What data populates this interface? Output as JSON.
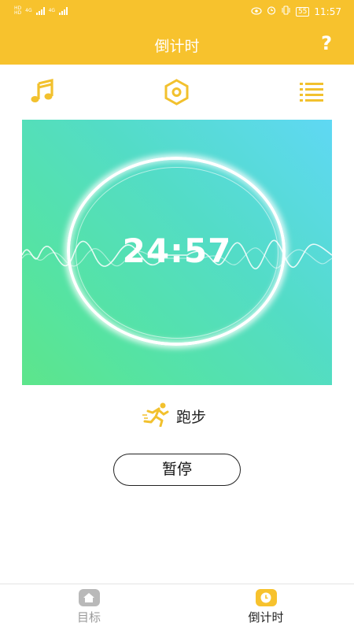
{
  "status_bar": {
    "network_left": [
      "4G",
      "4G"
    ],
    "time": "11:57",
    "battery": "55"
  },
  "header": {
    "title": "倒计时",
    "help_label": "?"
  },
  "toolbar": {
    "music_icon": "music-note-icon",
    "settings_icon": "hexagon-settings-icon",
    "list_icon": "list-icon"
  },
  "timer": {
    "value": "24:57"
  },
  "activity": {
    "icon": "running-person-icon",
    "label": "跑步"
  },
  "pause_button": {
    "label": "暂停"
  },
  "bottom_nav": {
    "items": [
      {
        "label": "目标",
        "icon": "home-icon",
        "active": false
      },
      {
        "label": "倒计时",
        "icon": "clock-icon",
        "active": true
      }
    ]
  },
  "colors": {
    "accent": "#f7c22d",
    "inactive": "#9a9a9a",
    "gradient_start": "#5fd8f4",
    "gradient_end": "#5de58b"
  }
}
